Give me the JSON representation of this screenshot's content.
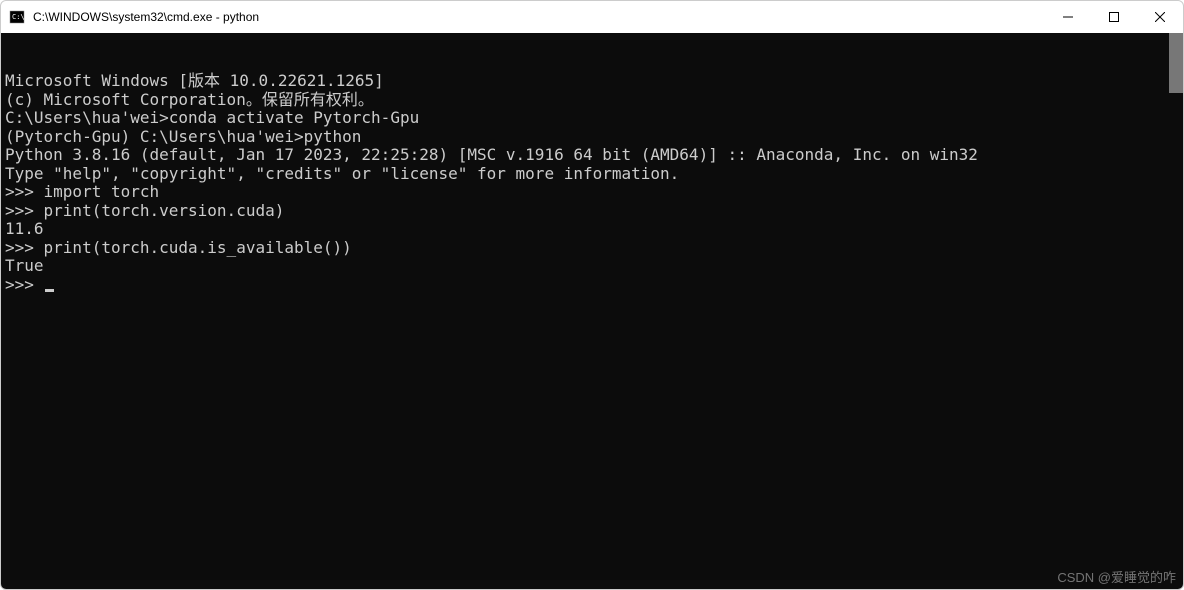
{
  "window": {
    "title": "C:\\WINDOWS\\system32\\cmd.exe - python"
  },
  "terminal": {
    "lines": [
      "Microsoft Windows [版本 10.0.22621.1265]",
      "(c) Microsoft Corporation。保留所有权利。",
      "",
      "C:\\Users\\hua'wei>conda activate Pytorch-Gpu",
      "",
      "(Pytorch-Gpu) C:\\Users\\hua'wei>python",
      "Python 3.8.16 (default, Jan 17 2023, 22:25:28) [MSC v.1916 64 bit (AMD64)] :: Anaconda, Inc. on win32",
      "Type \"help\", \"copyright\", \"credits\" or \"license\" for more information.",
      ">>> import torch",
      ">>> print(torch.version.cuda)",
      "11.6",
      ">>> print(torch.cuda.is_available())",
      "True",
      ">>> "
    ]
  },
  "watermark": "CSDN @爱睡觉的咋"
}
